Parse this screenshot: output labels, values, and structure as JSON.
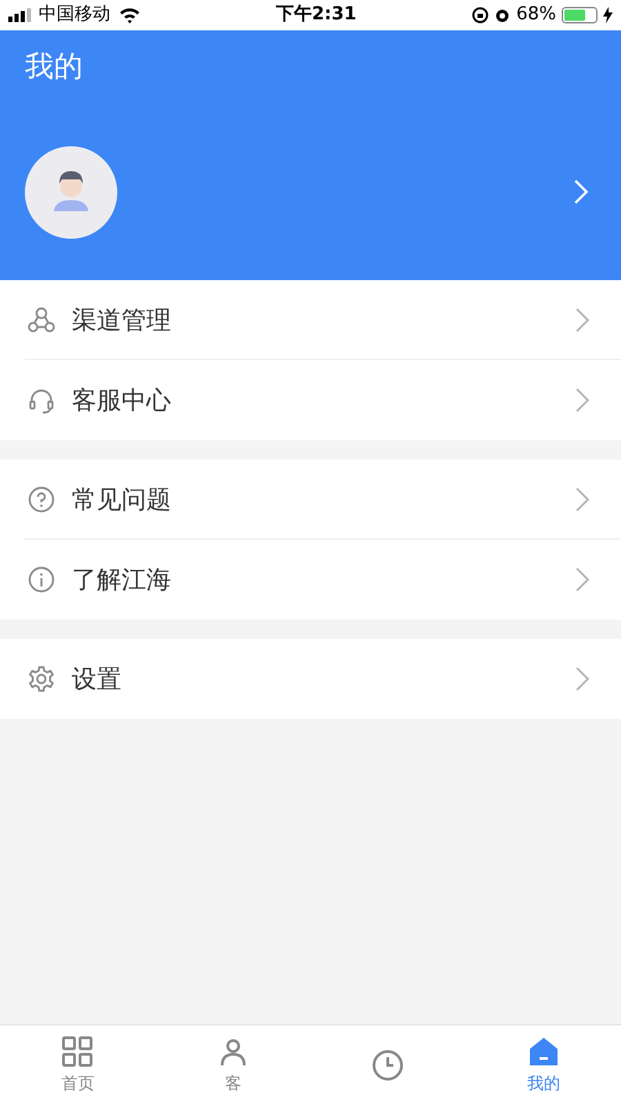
{
  "status_bar": {
    "carrier": "中国移动",
    "time": "下午2:31",
    "battery_text": "68%"
  },
  "header": {
    "title": "我的"
  },
  "menu_groups": [
    {
      "items": [
        {
          "kind": "channels",
          "label": "渠道管理"
        },
        {
          "kind": "support",
          "label": "客服中心"
        }
      ]
    },
    {
      "items": [
        {
          "kind": "faq",
          "label": "常见问题"
        },
        {
          "kind": "about",
          "label": "了解江海"
        }
      ]
    },
    {
      "items": [
        {
          "kind": "settings",
          "label": "设置"
        }
      ]
    }
  ],
  "tab_bar": [
    {
      "kind": "home",
      "label": "首页",
      "selected": false
    },
    {
      "kind": "customer",
      "label": "客",
      "selected": false
    },
    {
      "kind": "clock",
      "selected": false
    },
    {
      "kind": "profile",
      "label": "我的",
      "selected": true
    }
  ]
}
